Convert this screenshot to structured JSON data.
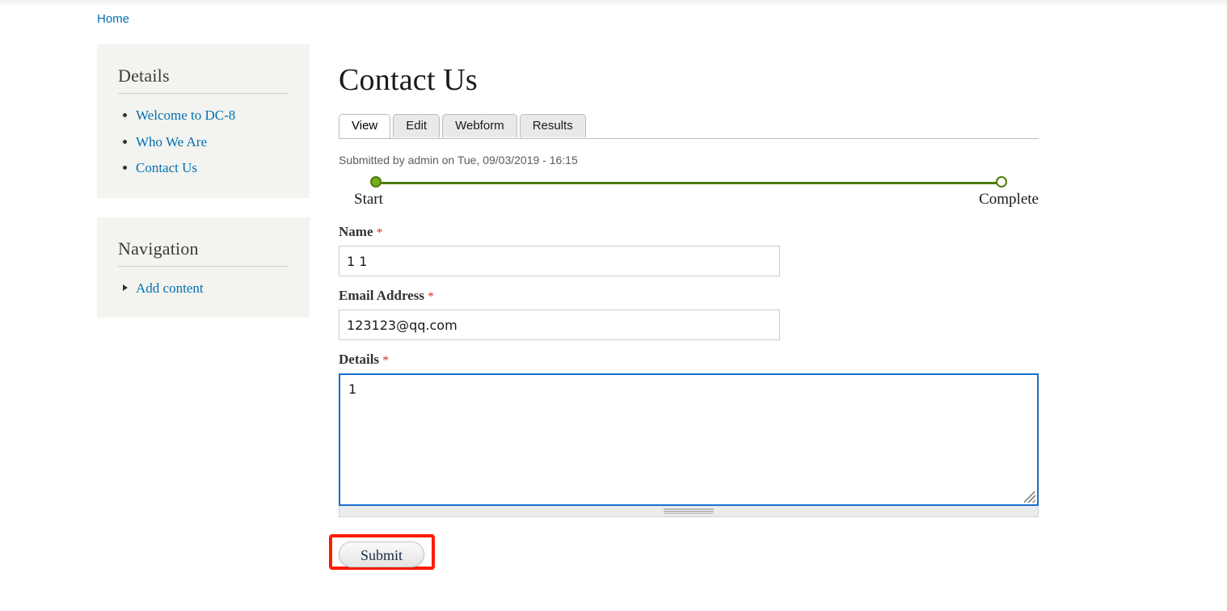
{
  "breadcrumb": {
    "items": [
      {
        "label": "Home"
      }
    ]
  },
  "sidebar": {
    "blocks": [
      {
        "title": "Details",
        "items": [
          {
            "label": "Welcome to DC-8",
            "marker": "bullet"
          },
          {
            "label": "Who We Are",
            "marker": "bullet"
          },
          {
            "label": "Contact Us",
            "marker": "bullet"
          }
        ]
      },
      {
        "title": "Navigation",
        "items": [
          {
            "label": "Add content",
            "marker": "arrow"
          }
        ]
      }
    ]
  },
  "main": {
    "title": "Contact Us",
    "tabs": [
      {
        "label": "View",
        "active": true
      },
      {
        "label": "Edit",
        "active": false
      },
      {
        "label": "Webform",
        "active": false
      },
      {
        "label": "Results",
        "active": false
      }
    ],
    "submitted": "Submitted by admin on Tue, 09/03/2019 - 16:15",
    "progress": {
      "start_label": "Start",
      "end_label": "Complete",
      "percent": 0,
      "track_color": "#4f7a0a",
      "done_color": "#72b01d"
    },
    "form": {
      "fields": [
        {
          "label": "Name",
          "required_mark": "*",
          "value": "1 1",
          "placeholder": "",
          "type": "text"
        },
        {
          "label": "Email Address",
          "required_mark": "*",
          "value": "123123@qq.com",
          "placeholder": "",
          "type": "email"
        },
        {
          "label": "Details",
          "required_mark": "*",
          "value": "1",
          "placeholder": "",
          "type": "textarea"
        }
      ],
      "submit_label": "Submit"
    }
  },
  "annotation": {
    "highlight_color": "#ff1a00",
    "target": "submit-button"
  },
  "colors": {
    "link": "#0071b3",
    "sidebar_bg": "#f3f3ef",
    "required": "#e02222",
    "focus_border": "#1a6ecb"
  }
}
